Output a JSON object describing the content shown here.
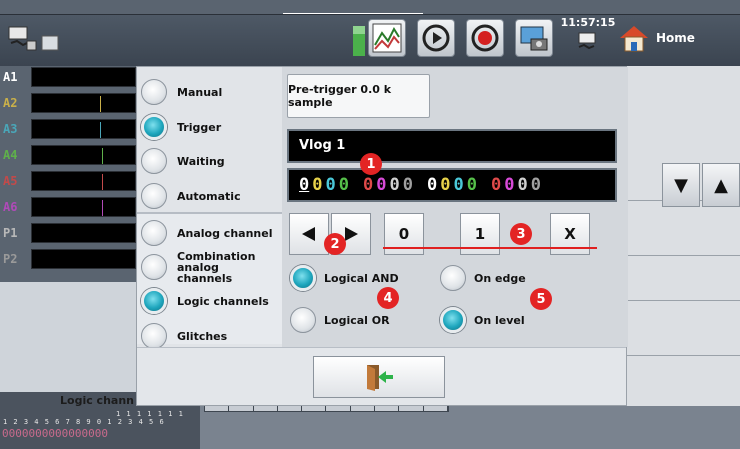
{
  "topbar": {
    "clock": "11:57:15",
    "home_label": "Home"
  },
  "channels": [
    {
      "label": "A1",
      "color": "#ffffff"
    },
    {
      "label": "A2",
      "color": "#c9b04a"
    },
    {
      "label": "A3",
      "color": "#4aa6b8"
    },
    {
      "label": "A4",
      "color": "#5fb04a"
    },
    {
      "label": "A5",
      "color": "#c24a4a"
    },
    {
      "label": "A6",
      "color": "#b04ab8"
    },
    {
      "label": "P1",
      "color": "#b8b8b8"
    },
    {
      "label": "P2",
      "color": "#9a9a9a"
    }
  ],
  "logic_panel": {
    "title": "Logic chann",
    "nums_top": "1 1 1 1 1 1 1",
    "nums_top2": "0 1 2 3 4 5 6",
    "nums_bottom": "1 2 3 4 5 6 7 8 9",
    "bits": "0000000000000000"
  },
  "dialog": {
    "trigger_modes": [
      {
        "label": "Manual",
        "selected": false
      },
      {
        "label": "Trigger",
        "selected": true
      },
      {
        "label": "Waiting",
        "selected": false
      },
      {
        "label": "Automatic",
        "selected": false
      }
    ],
    "channel_types": [
      {
        "label": "Analog channel",
        "selected": false
      },
      {
        "label": "Combination analog channels",
        "selected": false
      },
      {
        "label": "Logic channels",
        "selected": true
      },
      {
        "label": "Glitches",
        "selected": false
      }
    ],
    "pretrigger_label": "Pre-trigger 0.0 k sample",
    "channel_name": "Vlog  1",
    "bits": [
      {
        "value": "0",
        "color": "#ffffff",
        "underline": true
      },
      {
        "value": "0",
        "color": "#e6d24a"
      },
      {
        "value": "0",
        "color": "#4ac8d8"
      },
      {
        "value": "0",
        "color": "#56c04a"
      },
      {
        "value": "0",
        "color": "#e04a4a"
      },
      {
        "value": "0",
        "color": "#d84ad8"
      },
      {
        "value": "0",
        "color": "#d0d0d0"
      },
      {
        "value": "0",
        "color": "#a0a0a0"
      },
      {
        "value": "0",
        "color": "#ffffff"
      },
      {
        "value": "0",
        "color": "#e6d24a"
      },
      {
        "value": "0",
        "color": "#4ac8d8"
      },
      {
        "value": "0",
        "color": "#56c04a"
      },
      {
        "value": "0",
        "color": "#e04a4a"
      },
      {
        "value": "0",
        "color": "#d84ad8"
      },
      {
        "value": "0",
        "color": "#d0d0d0"
      },
      {
        "value": "0",
        "color": "#a0a0a0"
      }
    ],
    "btn_zero": "0",
    "btn_one": "1",
    "btn_x": "X",
    "logic_ops": [
      {
        "label": "Logical AND",
        "selected": true
      },
      {
        "label": "Logical OR",
        "selected": false
      }
    ],
    "edge_modes": [
      {
        "label": "On edge",
        "selected": false
      },
      {
        "label": "On level",
        "selected": true
      }
    ],
    "badges": [
      "1",
      "2",
      "3",
      "4",
      "5"
    ]
  },
  "colors": {
    "accent": "#1ea6bd",
    "badge": "#e32424"
  }
}
